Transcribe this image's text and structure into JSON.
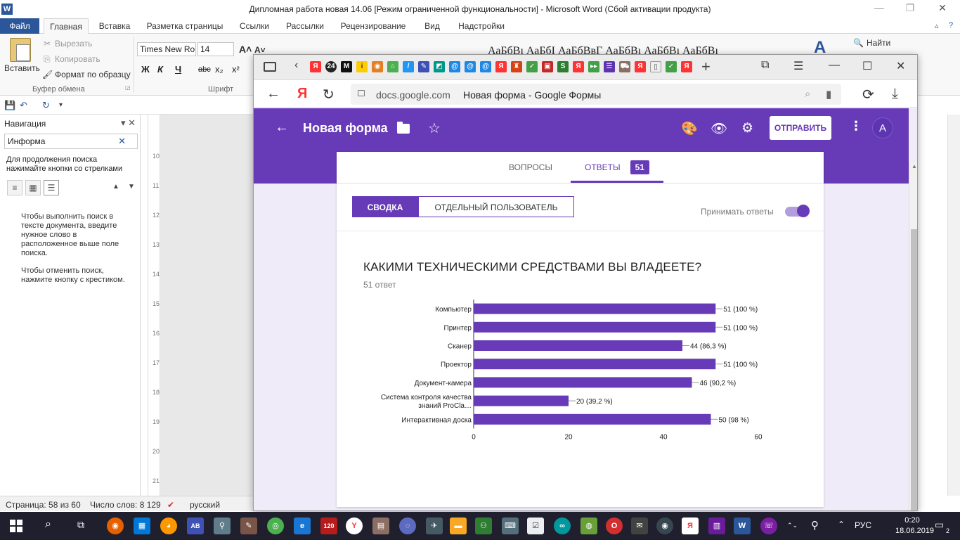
{
  "word": {
    "title": "Дипломная работа новая 14.06 [Режим ограниченной функциональности]  -  Microsoft Word (Сбой активации продукта)",
    "logo": "W",
    "tabs": [
      "Файл",
      "Главная",
      "Вставка",
      "Разметка страницы",
      "Ссылки",
      "Рассылки",
      "Рецензирование",
      "Вид",
      "Надстройки"
    ],
    "ribbon": {
      "paste": "Вставить",
      "cut": "Вырезать",
      "copy": "Копировать",
      "format_painter": "Формат по образцу",
      "clipboard_group": "Буфер обмена",
      "font_name": "Times New Ro",
      "font_size": "14",
      "font_group": "Шрифт",
      "styles_preview": "АаБбВı  АаБбI  АаБбВвГ  АаБбВı  АаБбВı  АаБбВı",
      "find": "Найти",
      "bold": "Ж",
      "italic": "К",
      "underline": "Ч",
      "strike": "abc",
      "subscript": "x₂",
      "superscript": "x²"
    },
    "nav_pane": {
      "title": "Навигация",
      "search_value": "Информа",
      "hint": "Для продолжения поиска нажимайте кнопки со стрелками",
      "message1": "Чтобы выполнить поиск в тексте документа, введите нужное слово в расположенное выше поле поиска.",
      "message2": "Чтобы отменить поиск, нажмите кнопку с крестиком."
    },
    "ruler_ticks": [
      "10",
      "11",
      "12",
      "13",
      "14",
      "15",
      "16",
      "17",
      "18",
      "19",
      "20",
      "21"
    ],
    "status": {
      "page": "Страница: 58 из 60",
      "words": "Число слов: 8 129",
      "language": "русский"
    }
  },
  "browser": {
    "address_domain": "docs.google.com",
    "page_title": "Новая форма - Google Формы",
    "yandex_logo": "Я"
  },
  "form": {
    "title": "Новая форма",
    "send_label": "ОТПРАВИТЬ",
    "avatar_letter": "А",
    "tabs": {
      "questions": "ВОПРОСЫ",
      "responses": "ОТВЕТЫ",
      "responses_count": "51"
    },
    "summary_label": "СВОДКА",
    "individual_label": "ОТДЕЛЬНЫЙ ПОЛЬЗОВАТЕЛЬ",
    "accept_label": "Принимать ответы",
    "question": "КАКИМИ ТЕХНИЧЕСКИМИ СРЕДСТВАМИ ВЫ ВЛАДЕЕТЕ?",
    "answer_count": "51 ответ"
  },
  "chart_data": {
    "type": "bar",
    "orientation": "horizontal",
    "categories": [
      "Компьютер",
      "Принтер",
      "Сканер",
      "Проектор",
      "Документ-камера",
      "Система контроля качества знаний ProCla…",
      "Интерактивная доска"
    ],
    "values": [
      51,
      51,
      44,
      51,
      46,
      20,
      50
    ],
    "labels": [
      "51 (100 %)",
      "51 (100 %)",
      "44 (86,3 %)",
      "51 (100 %)",
      "46 (90,2 %)",
      "20 (39,2 %)",
      "50 (98 %)"
    ],
    "xlim": [
      0,
      60
    ],
    "xticks": [
      "0",
      "20",
      "40",
      "60"
    ],
    "color": "#673ab7",
    "grid": false
  },
  "taskbar": {
    "lang": "РУС",
    "time": "0:20",
    "date": "18.06.2019",
    "notifications": "2"
  }
}
